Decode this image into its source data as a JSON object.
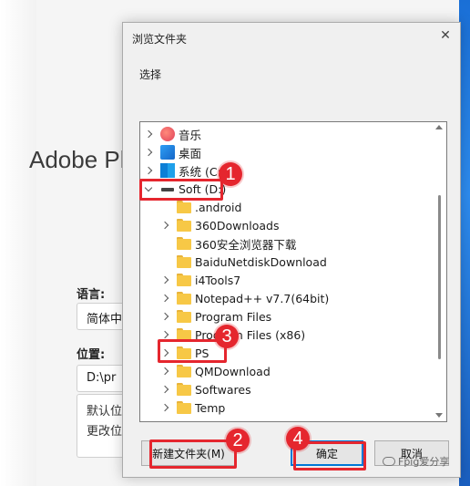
{
  "background": {
    "app_title": "Adobe Ph",
    "language_label": "语言:",
    "language_value": "简体中",
    "location_label": "位置:",
    "location_value": "D:\\pr",
    "note_line1": "默认位",
    "note_line2": "更改位"
  },
  "dialog": {
    "title": "浏览文件夹",
    "prompt": "选择",
    "close_icon": "close-icon",
    "tree": [
      {
        "label": "音乐",
        "icon": "music-icon",
        "level": 0,
        "expander": "collapsed"
      },
      {
        "label": "桌面",
        "icon": "desktop-icon",
        "level": 0,
        "expander": "collapsed"
      },
      {
        "label": "系统 (C:)",
        "icon": "system-drive-icon",
        "level": 0,
        "expander": "collapsed"
      },
      {
        "label": "Soft (D:)",
        "icon": "drive-icon",
        "level": 0,
        "expander": "expanded"
      },
      {
        "label": ".android",
        "icon": "folder-icon",
        "level": 1,
        "expander": "none"
      },
      {
        "label": "360Downloads",
        "icon": "folder-icon",
        "level": 1,
        "expander": "collapsed"
      },
      {
        "label": "360安全浏览器下载",
        "icon": "folder-icon",
        "level": 1,
        "expander": "none"
      },
      {
        "label": "BaiduNetdiskDownload",
        "icon": "folder-icon",
        "level": 1,
        "expander": "none"
      },
      {
        "label": "i4Tools7",
        "icon": "folder-icon",
        "level": 1,
        "expander": "collapsed"
      },
      {
        "label": "Notepad++ v7.7(64bit)",
        "icon": "folder-icon",
        "level": 1,
        "expander": "collapsed"
      },
      {
        "label": "Program Files",
        "icon": "folder-icon",
        "level": 1,
        "expander": "collapsed"
      },
      {
        "label": "Program Files (x86)",
        "icon": "folder-icon",
        "level": 1,
        "expander": "collapsed"
      },
      {
        "label": "PS",
        "icon": "folder-icon",
        "level": 1,
        "expander": "collapsed"
      },
      {
        "label": "QMDownload",
        "icon": "folder-icon",
        "level": 1,
        "expander": "collapsed"
      },
      {
        "label": "Softwares",
        "icon": "folder-icon",
        "level": 1,
        "expander": "collapsed"
      },
      {
        "label": "Temp",
        "icon": "folder-icon",
        "level": 1,
        "expander": "collapsed"
      }
    ],
    "buttons": {
      "new_folder": "新建文件夹(M)",
      "ok": "确定",
      "cancel": "取消"
    }
  },
  "annotations": {
    "step1": "1",
    "step2": "2",
    "step3": "3",
    "step4": "4",
    "color": "#e5262e"
  },
  "watermark": "Fpig爱分享"
}
